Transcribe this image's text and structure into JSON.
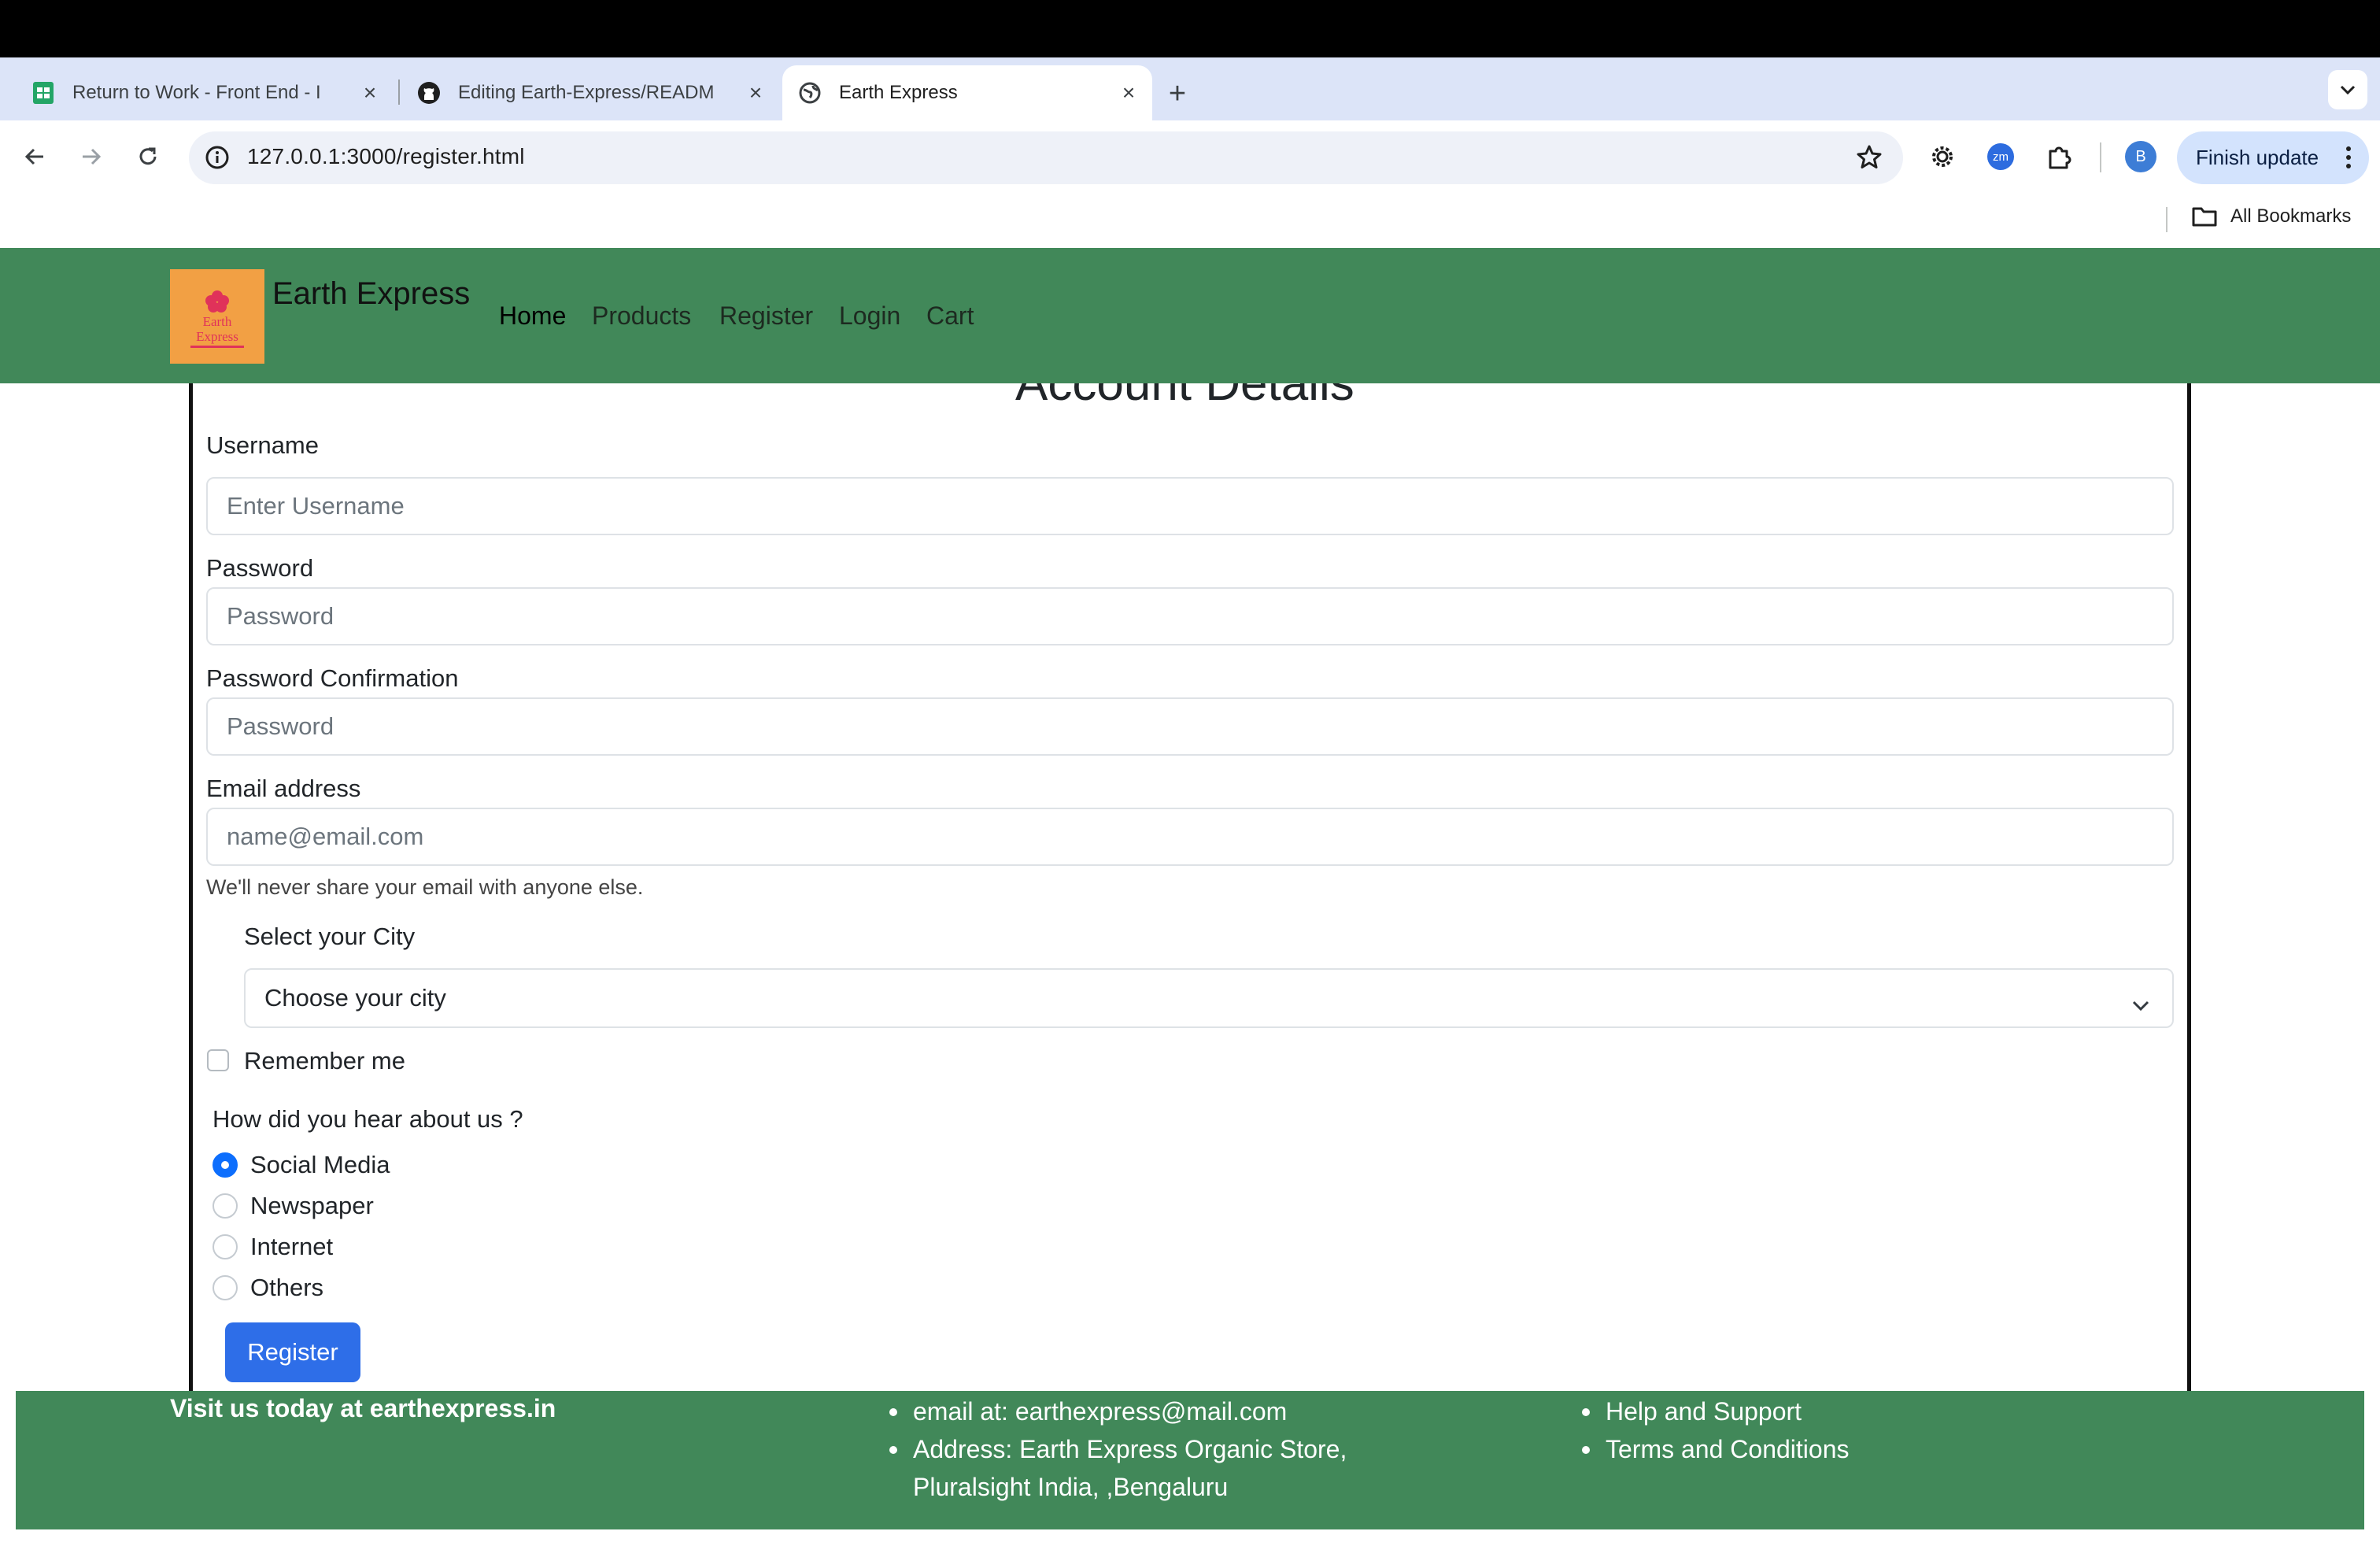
{
  "browser": {
    "tabs": [
      {
        "title": "Return to Work - Front End - I",
        "icon": "google-sheets-icon",
        "active": false
      },
      {
        "title": "Editing Earth-Express/READM",
        "icon": "github-icon",
        "active": false
      },
      {
        "title": "Earth Express",
        "icon": "globe-icon",
        "active": true
      }
    ],
    "url": "127.0.0.1:3000/register.html",
    "profile_initial": "B",
    "finish_update_label": "Finish update",
    "extension_zoom_label": "zm",
    "all_bookmarks_label": "All Bookmarks"
  },
  "site": {
    "brand": "Earth Express",
    "logo_text": [
      "Earth",
      "Express"
    ],
    "nav": [
      "Home",
      "Products",
      "Register",
      "Login",
      "Cart"
    ]
  },
  "form": {
    "heading": "Account Details",
    "username_label": "Username",
    "username_placeholder": "Enter Username",
    "password_label": "Password",
    "password_placeholder": "Password",
    "password_confirm_label": "Password Confirmation",
    "password_confirm_placeholder": "Password",
    "email_label": "Email address",
    "email_placeholder": "name@email.com",
    "email_help": "We'll never share your email with anyone else.",
    "city_label": "Select your City",
    "city_selected": "Choose your city",
    "remember_label": "Remember me",
    "hear_question": "How did you hear about us ?",
    "hear_options": [
      {
        "label": "Social Media",
        "checked": true
      },
      {
        "label": "Newspaper",
        "checked": false
      },
      {
        "label": "Internet",
        "checked": false
      },
      {
        "label": "Others",
        "checked": false
      }
    ],
    "register_label": "Register"
  },
  "footer": {
    "visit": "Visit us today at earthexpress.in",
    "contact": [
      "email at: earthexpress@mail.com",
      "Address: Earth Express Organic Store,",
      "Pluralsight India, ,Bengaluru"
    ],
    "links": [
      "Help and Support",
      "Terms and Conditions"
    ]
  },
  "colors": {
    "site_green": "#418859",
    "primary_blue": "#2e6ee8",
    "logo_orange": "#f2a044"
  }
}
